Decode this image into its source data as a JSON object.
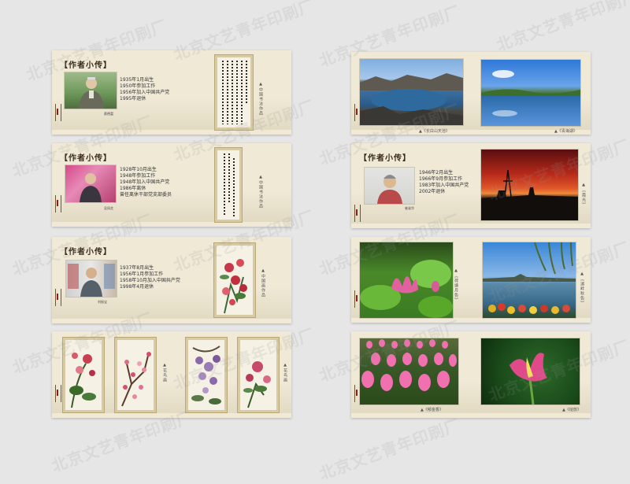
{
  "watermark": "北京文艺青年印刷厂",
  "colors": {
    "background": "#e6e6e6",
    "panel": "#efe9d6",
    "accent_red": "#8a1f1a"
  },
  "left_column": {
    "panel1": {
      "heading": "【作者小传】",
      "bio": [
        "1935年1月出生",
        "1950年参加工作",
        "1956年加入中国共产党",
        "1995年退休"
      ],
      "signature": "蔡德富",
      "caption": "▲中国书法作品"
    },
    "panel2": {
      "heading": "【作者小传】",
      "bio": [
        "1928年10月出生",
        "1948年参加工作",
        "1948年加入中国共产党",
        "1986年离休",
        "曾任离休干部党支部委员"
      ],
      "signature": "吴凤芝",
      "caption": "▲中国书法作品"
    },
    "panel3": {
      "heading": "【作者小传】",
      "bio": [
        "1937年8月出生",
        "1956年1月参加工作",
        "1958年10月加入中国共产党",
        "1998年4月退休"
      ],
      "signature": "刘振宝",
      "caption": "▲中国画作品"
    },
    "panel4": {
      "captions": [
        "▲花鸟画",
        "▲花鸟画"
      ]
    }
  },
  "right_column": {
    "panel1": {
      "captions": [
        "▲《长白山天池》",
        "▲《青海湖》"
      ]
    },
    "panel2": {
      "heading": "【作者小传】",
      "bio": [
        "1946年2月出生",
        "1966年9月参加工作",
        "1983年加入中国共产党",
        "2002年退休"
      ],
      "signature": "崔淑华",
      "caption": "▲《霞光》"
    },
    "panel3": {
      "captions": [
        "▲《荷塘月色》",
        "▲《湖畔秋色》"
      ]
    },
    "panel4": {
      "captions": [
        "▲《郁金香》",
        "▲《绽放》"
      ]
    }
  }
}
